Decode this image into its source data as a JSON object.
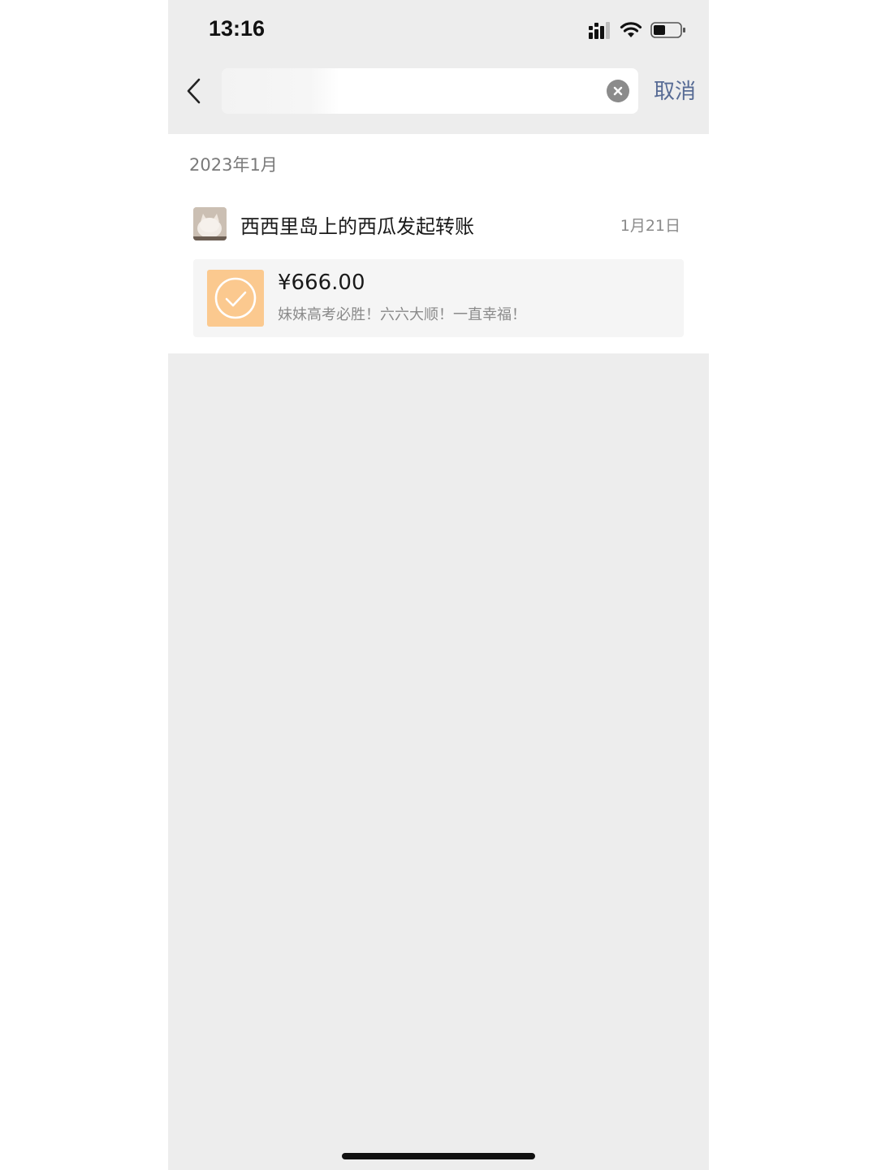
{
  "status_bar": {
    "time": "13:16",
    "icons": [
      "signal-icon",
      "wifi-icon",
      "battery-icon"
    ]
  },
  "search": {
    "query": "",
    "placeholder": "",
    "cancel_label": "取消"
  },
  "results": {
    "groups": [
      {
        "date_header": "2023年1月",
        "items": [
          {
            "title": "西西里岛上的西瓜发起转账",
            "date": "1月21日",
            "transfer": {
              "amount": "¥666.00",
              "note": "妹妹高考必胜！六六大顺！一直幸福！"
            }
          }
        ]
      }
    ]
  },
  "colors": {
    "accent_link": "#576b95",
    "transfer_icon_bg": "#fbc98f",
    "background": "#ededed"
  }
}
